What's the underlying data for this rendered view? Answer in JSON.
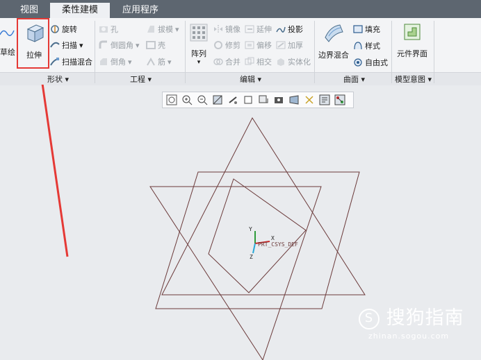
{
  "tabs": [
    "视图",
    "柔性建模",
    "应用程序"
  ],
  "ribbon": {
    "sketch_label": "草绘",
    "extrude_label": "拉伸",
    "revolve_label": "旋转",
    "sweep_label": "扫描",
    "swept_blend_label": "扫描混合",
    "hole_label": "孔",
    "draft_label": "拔模",
    "round_label": "倒圆角",
    "shell_label": "壳",
    "chamfer_label": "倒角",
    "rib_label": "筋",
    "pattern_label": "阵列",
    "mirror_label": "镜像",
    "extend_label": "延伸",
    "project_label": "投影",
    "trim_label": "修剪",
    "offset_label": "偏移",
    "thicken_label": "加厚",
    "merge_label": "合并",
    "intersect_label": "相交",
    "solidify_label": "实体化",
    "boundary_blend_label": "边界混合",
    "fill_label": "填充",
    "style_label": "样式",
    "freestyle_label": "自由式",
    "component_interface_label": "元件界面"
  },
  "groups": {
    "shape": "形状",
    "engineering": "工程",
    "editing": "编辑",
    "surfaces": "曲面",
    "model_intent": "模型意图"
  },
  "canvas": {
    "csys_label": "PRT_CSYS_DEF",
    "x_axis": "X",
    "y_axis": "Y",
    "z_axis": "Z"
  },
  "watermark": {
    "brand": "搜狗指南",
    "url": "zhinan.sogou.com"
  },
  "colors": {
    "annotation_red": "#e53935",
    "sketch_line": "#6b3a3a"
  }
}
